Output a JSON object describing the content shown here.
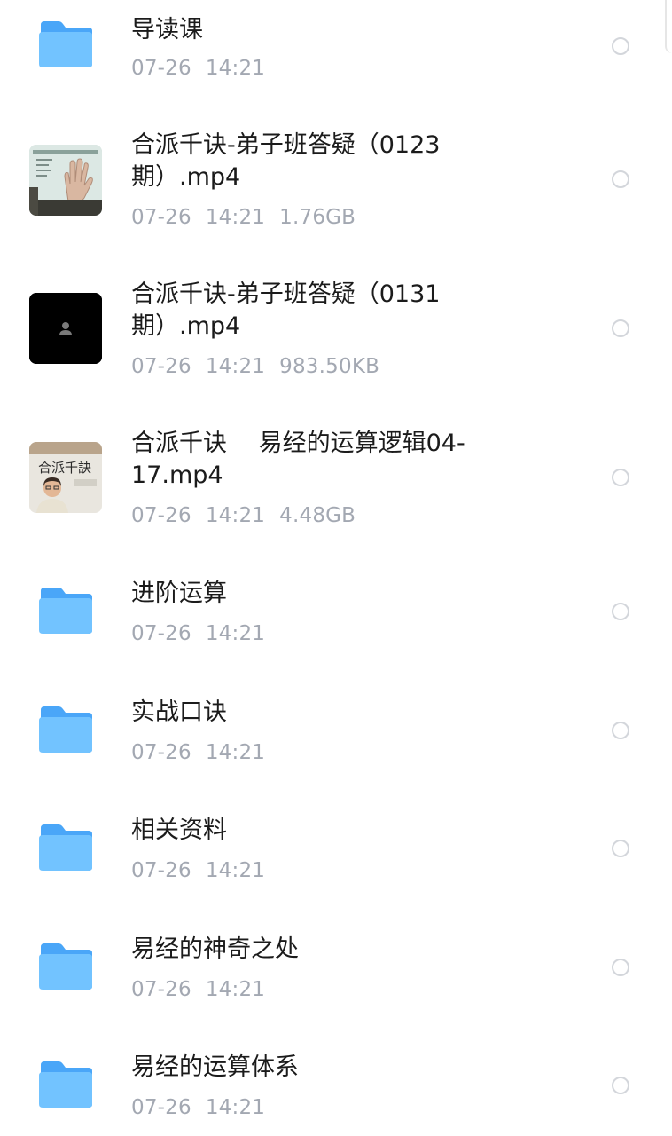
{
  "colors": {
    "folder_back": "#4aa6f8",
    "folder_front": "#6ec2ff",
    "meta_text": "#a3a8b2",
    "title_text": "#1b1b1b"
  },
  "items": [
    {
      "kind": "folder",
      "icon": "folder-icon",
      "title": "导读课",
      "date": "07-26",
      "time": "14:21",
      "size": ""
    },
    {
      "kind": "video",
      "icon": "video-thumbnail-palm-slide",
      "title": "合派千诀-弟子班答疑（0123期）.mp4",
      "date": "07-26",
      "time": "14:21",
      "size": "1.76GB"
    },
    {
      "kind": "video",
      "icon": "video-thumbnail-black-avatar",
      "title": "合派千诀-弟子班答疑（0131期）.mp4",
      "date": "07-26",
      "time": "14:21",
      "size": "983.50KB"
    },
    {
      "kind": "video",
      "icon": "video-thumbnail-lecturer",
      "title": "合派千诀　 易经的运算逻辑04-17.mp4",
      "date": "07-26",
      "time": "14:21",
      "size": "4.48GB"
    },
    {
      "kind": "folder",
      "icon": "folder-icon",
      "title": "进阶运算",
      "date": "07-26",
      "time": "14:21",
      "size": ""
    },
    {
      "kind": "folder",
      "icon": "folder-icon",
      "title": "实战口诀",
      "date": "07-26",
      "time": "14:21",
      "size": ""
    },
    {
      "kind": "folder",
      "icon": "folder-icon",
      "title": "相关资料",
      "date": "07-26",
      "time": "14:21",
      "size": ""
    },
    {
      "kind": "folder",
      "icon": "folder-icon",
      "title": "易经的神奇之处",
      "date": "07-26",
      "time": "14:21",
      "size": ""
    },
    {
      "kind": "folder",
      "icon": "folder-icon",
      "title": "易经的运算体系",
      "date": "07-26",
      "time": "14:21",
      "size": ""
    }
  ],
  "thumbnail_texts": {
    "lecturer_banner": "合派千訣"
  }
}
